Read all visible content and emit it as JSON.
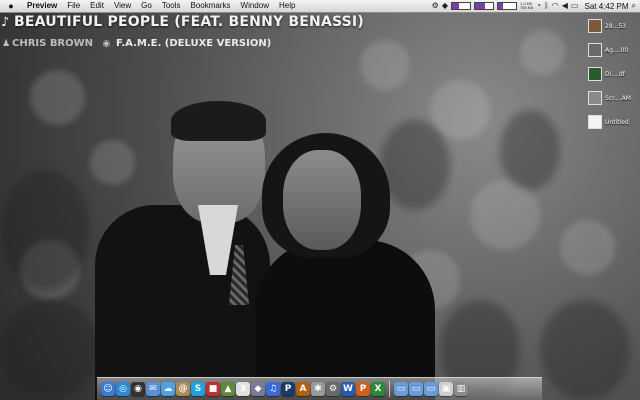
{
  "menubar": {
    "app_name": "Preview",
    "menus": [
      "File",
      "Edit",
      "View",
      "Go",
      "Tools",
      "Bookmarks",
      "Window",
      "Help"
    ],
    "net_up": "1.0 KB",
    "net_down": "755 KB",
    "clock": "Sat 4:42 PM"
  },
  "now_playing": {
    "title": "BEAUTIFUL PEOPLE (FEAT. BENNY BENASSI)",
    "artist": "CHRIS BROWN",
    "album": "F.A.M.E. (DELUXE VERSION)"
  },
  "desktop_items": [
    {
      "label": "28...53",
      "color": "#7a5a3a"
    },
    {
      "label": "Ag....00",
      "color": "#6a6a6a"
    },
    {
      "label": "Di....df",
      "color": "#2a5a2a"
    },
    {
      "label": "Scr....AM",
      "color": "#8a8a8a"
    },
    {
      "label": "Untitled",
      "color": "#f4f4f4"
    }
  ],
  "dock": {
    "icons": [
      {
        "name": "finder-icon",
        "color": "#3a7bd5",
        "glyph": "☺"
      },
      {
        "name": "safari-icon",
        "color": "#2a8ad8",
        "glyph": "◎"
      },
      {
        "name": "dashboard-icon",
        "color": "#333333",
        "glyph": "◉"
      },
      {
        "name": "mail-icon",
        "color": "#5b8fd6",
        "glyph": "✉"
      },
      {
        "name": "ichat-icon",
        "color": "#4aa0e6",
        "glyph": "☁"
      },
      {
        "name": "address-book-icon",
        "color": "#b08a55",
        "glyph": "@"
      },
      {
        "name": "skype-icon",
        "color": "#1ea3e0",
        "glyph": "S"
      },
      {
        "name": "photo-booth-icon",
        "color": "#c03030",
        "glyph": "■"
      },
      {
        "name": "iphoto-icon",
        "color": "#5a8a3a",
        "glyph": "▲"
      },
      {
        "name": "calendar-icon",
        "color": "#e0e0e0",
        "glyph": "3"
      },
      {
        "name": "preview-icon",
        "color": "#7a7a9a",
        "glyph": "◆"
      },
      {
        "name": "itunes-icon",
        "color": "#3a6ad8",
        "glyph": "♫"
      },
      {
        "name": "photoshop-icon",
        "color": "#1a3a6a",
        "glyph": "P"
      },
      {
        "name": "illustrator-icon",
        "color": "#b06010",
        "glyph": "A"
      },
      {
        "name": "utilities-icon",
        "color": "#9a9a9a",
        "glyph": "✱"
      },
      {
        "name": "system-preferences-icon",
        "color": "#6a6a6a",
        "glyph": "⚙"
      },
      {
        "name": "word-icon",
        "color": "#2a5ab0",
        "glyph": "W"
      },
      {
        "name": "powerpoint-icon",
        "color": "#d06020",
        "glyph": "P"
      },
      {
        "name": "excel-icon",
        "color": "#2a8a3a",
        "glyph": "X"
      },
      {
        "name": "applications-folder-icon",
        "color": "#6a9ad8",
        "glyph": "▭"
      },
      {
        "name": "documents-folder-icon",
        "color": "#6a9ad8",
        "glyph": "▭"
      },
      {
        "name": "downloads-folder-icon",
        "color": "#6a9ad8",
        "glyph": "▭"
      },
      {
        "name": "screenshot-stack-icon",
        "color": "#cfcfcf",
        "glyph": "▣"
      },
      {
        "name": "trash-icon",
        "color": "#8a8a8a",
        "glyph": "▥"
      }
    ]
  }
}
